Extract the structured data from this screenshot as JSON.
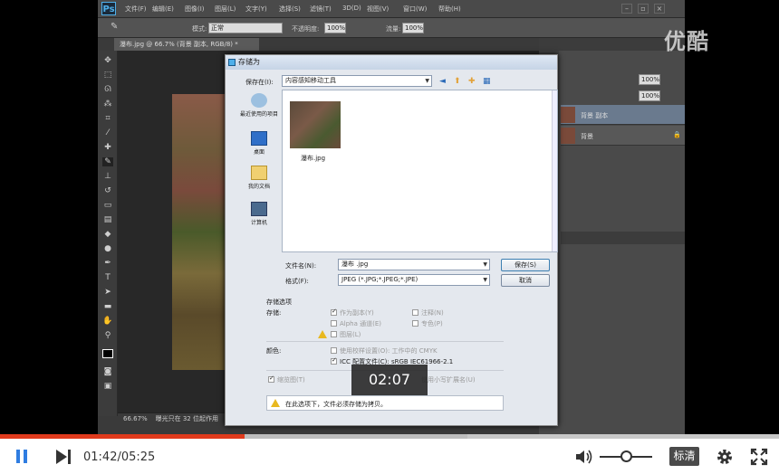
{
  "photoshop": {
    "logo": "Ps",
    "menus": [
      "文件(F)",
      "编辑(E)",
      "图像(I)",
      "图层(L)",
      "文字(Y)",
      "选择(S)",
      "滤镜(T)",
      "3D(D)",
      "视图(V)",
      "窗口(W)",
      "帮助(H)"
    ],
    "options": {
      "mode_label": "模式:",
      "mode_value": "正常",
      "opacity_label": "不透明度:",
      "opacity_value": "100%",
      "flow_label": "流量:",
      "flow_value": "100%"
    },
    "doc_tab": "瀑布.jpg @ 66.7% (背景 副本, RGB/8) *",
    "status_zoom": "66.67%",
    "status_doc": "曝光只在 32 位起作用",
    "layers": [
      {
        "name": "背景 副本"
      },
      {
        "name": "背景"
      }
    ],
    "layers_opacity": "100%",
    "layers_fill": "100%"
  },
  "save_dialog": {
    "title": "存储为",
    "save_in_label": "保存在(I):",
    "save_in_value": "内容感知移动工具",
    "places": [
      "最近使用的项目",
      "桌面",
      "我的文档",
      "计算机"
    ],
    "file_name": "瀑布.jpg",
    "file_name_label": "文件名(N):",
    "file_name_value": "瀑布 .jpg",
    "format_label": "格式(F):",
    "format_value": "JPEG (*.JPG;*.JPEG;*.JPE)",
    "save_button": "保存(S)",
    "cancel_button": "取消",
    "save_options_title": "存储选项",
    "save_label": "存储:",
    "options": {
      "as_copy": "作为副本(Y)",
      "notes": "注释(N)",
      "alpha": "Alpha 通道(E)",
      "spot": "专色(P)",
      "layers": "图层(L)"
    },
    "color_label": "颜色:",
    "proof": "使用校样设置(O): 工作中的 CMYK",
    "icc": "ICC 配置文件(C): sRGB IEC61966-2.1",
    "thumbnail": "缩览图(T)",
    "lower_ext": "使用小写扩展名(U)",
    "warning": "在此选项下，文件必须存储为拷贝。"
  },
  "overlay": {
    "watermark": "优酷",
    "hover_time": "02:07"
  },
  "player": {
    "current_time": "01:42",
    "duration": "05:25",
    "time_text": "01:42/05:25",
    "progress": 0.314,
    "buffered": 0.6,
    "volume": 0.5,
    "quality": "标清",
    "accent": "#e03a1c",
    "play_color": "#2f7de1"
  }
}
